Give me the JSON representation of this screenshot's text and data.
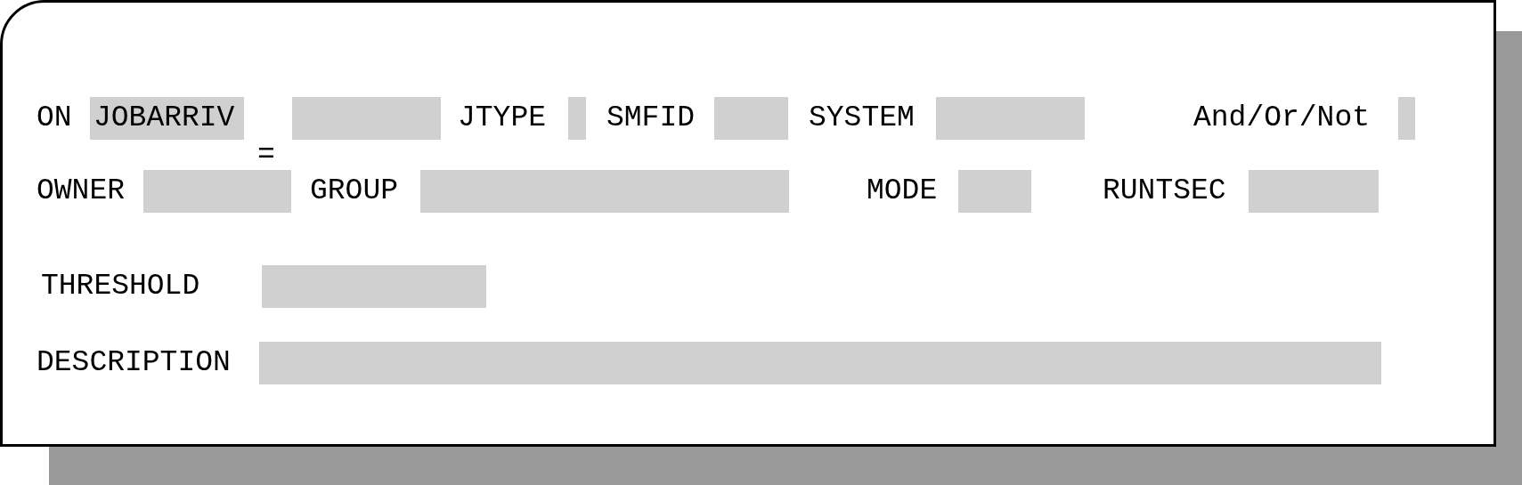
{
  "rows": [
    {
      "items": [
        {
          "kind": "label",
          "text": "ON"
        },
        {
          "kind": "field",
          "value": "JOBARRIV"
        },
        {
          "kind": "field"
        },
        {
          "kind": "label",
          "text": "JTYPE"
        },
        {
          "kind": "field"
        },
        {
          "kind": "label",
          "text": "SMFID"
        },
        {
          "kind": "field"
        },
        {
          "kind": "label",
          "text": "SYSTEM"
        },
        {
          "kind": "field"
        },
        {
          "kind": "label",
          "text": "And/Or/Not"
        },
        {
          "kind": "field"
        }
      ]
    },
    {
      "items": [
        {
          "kind": "symbol",
          "text": "="
        }
      ]
    },
    {
      "items": [
        {
          "kind": "label",
          "text": "OWNER"
        },
        {
          "kind": "field"
        },
        {
          "kind": "label",
          "text": "GROUP"
        },
        {
          "kind": "field"
        },
        {
          "kind": "label",
          "text": "MODE"
        },
        {
          "kind": "field"
        },
        {
          "kind": "label",
          "text": "RUNTSEC"
        },
        {
          "kind": "field"
        }
      ]
    },
    {
      "items": [
        {
          "kind": "label",
          "text": "THRESHOLD"
        },
        {
          "kind": "field"
        }
      ]
    },
    {
      "items": [
        {
          "kind": "label",
          "text": "DESCRIPTION"
        },
        {
          "kind": "field"
        }
      ]
    }
  ]
}
